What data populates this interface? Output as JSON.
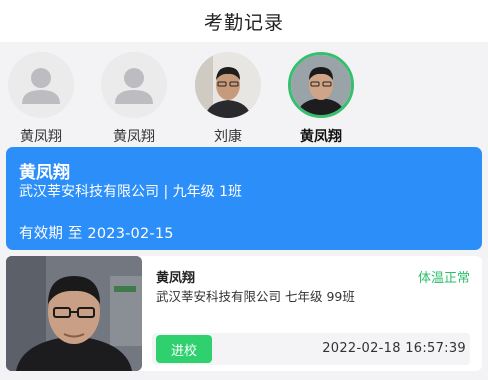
{
  "header": {
    "title": "考勤记录"
  },
  "people": [
    {
      "name": "黄凤翔",
      "avatar": "default-avatar-icon",
      "selected": false
    },
    {
      "name": "黄凤翔",
      "avatar": "default-avatar-icon",
      "selected": false
    },
    {
      "name": "刘康",
      "avatar": "photo",
      "selected": false
    },
    {
      "name": "黄凤翔",
      "avatar": "photo",
      "selected": true
    }
  ],
  "info_card": {
    "name": "黄凤翔",
    "school_class": "武汉莘安科技有限公司 | 九年级 1班",
    "validity": "有效期 至 2023-02-15"
  },
  "record": {
    "name": "黄凤翔",
    "temperature_status": "体温正常",
    "school_class": "武汉莘安科技有限公司 七年级 99班",
    "action": "进校",
    "timestamp": "2022-02-18 16:57:39"
  },
  "colors": {
    "accent_blue": "#2b8ef9",
    "selected_ring": "#35bf6e",
    "status_green": "#2fbf6a",
    "button_green": "#2fd16f"
  }
}
